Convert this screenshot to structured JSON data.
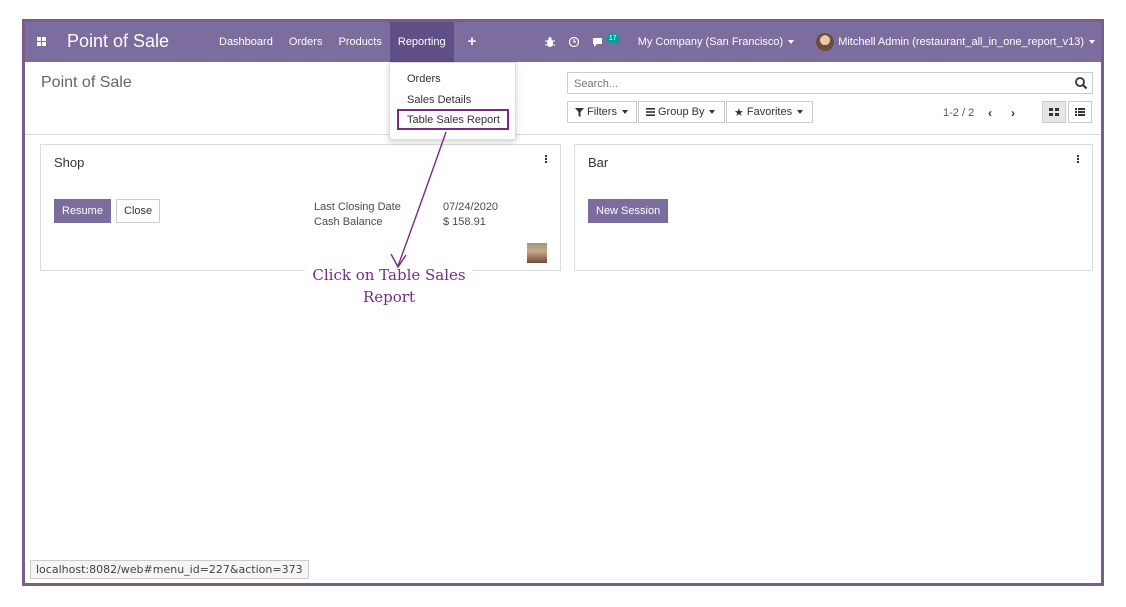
{
  "navbar": {
    "brand": "Point of Sale",
    "menu": [
      "Dashboard",
      "Orders",
      "Products",
      "Reporting"
    ],
    "active_menu": "Reporting",
    "plus": "+",
    "chat_count": "17",
    "company": "My Company (San Francisco)",
    "user": "Mitchell Admin (restaurant_all_in_one_report_v13)"
  },
  "reporting_dropdown": {
    "items": [
      "Orders",
      "Sales Details",
      "Table Sales Report"
    ]
  },
  "control": {
    "page_title": "Point of Sale",
    "search_placeholder": "Search...",
    "filters_label": "Filters",
    "groupby_label": "Group By",
    "favorites_label": "Favorites",
    "pager": "1-2 / 2"
  },
  "cards": {
    "shop": {
      "title": "Shop",
      "resume_label": "Resume",
      "close_label": "Close",
      "last_closing_label": "Last Closing Date",
      "last_closing_value": "07/24/2020",
      "cash_balance_label": "Cash Balance",
      "cash_balance_value": "$ 158.91"
    },
    "bar": {
      "title": "Bar",
      "new_session_label": "New Session"
    }
  },
  "annotation": {
    "line1": "Click on Table Sales",
    "line2": "Report"
  },
  "status_url": "localhost:8082/web#menu_id=227&action=373",
  "colors": {
    "navbar": "#7c6d9f",
    "primary": "#7c6d9f",
    "annotation": "#7a2a86",
    "badge": "#00a09d"
  },
  "icons": [
    "apps-grid-icon",
    "bug-icon",
    "clock-icon",
    "chat-icon",
    "search-icon",
    "filter-icon",
    "groupby-icon",
    "star-icon",
    "chevron-left-icon",
    "chevron-right-icon",
    "kanban-view-icon",
    "list-view-icon",
    "kebab-icon"
  ]
}
